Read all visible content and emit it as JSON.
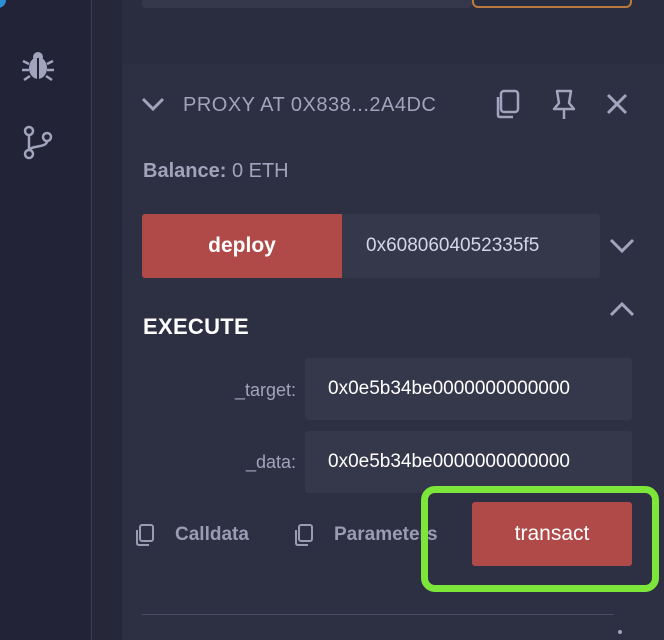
{
  "sidebar": {
    "icons": [
      "bug-icon",
      "git-branch-icon"
    ]
  },
  "proxy": {
    "title": "PROXY AT 0X838...2A4DC",
    "balance_label": "Balance:",
    "balance_value": "0 ETH"
  },
  "deploy": {
    "label": "deploy",
    "value": "0x6080604052335f5"
  },
  "execute": {
    "title": "EXECUTE",
    "params": [
      {
        "label": "_target:",
        "value": "0x0e5b34be0000000000000"
      },
      {
        "label": "_data:",
        "value": "0x0e5b34be0000000000000"
      }
    ],
    "calldata_label": "Calldata",
    "parameters_label": "Parameters",
    "transact_label": "transact"
  },
  "colors": {
    "accent_red": "#b04a48",
    "highlight_green": "#7ce63a",
    "panel_bg": "#2d2f42"
  }
}
